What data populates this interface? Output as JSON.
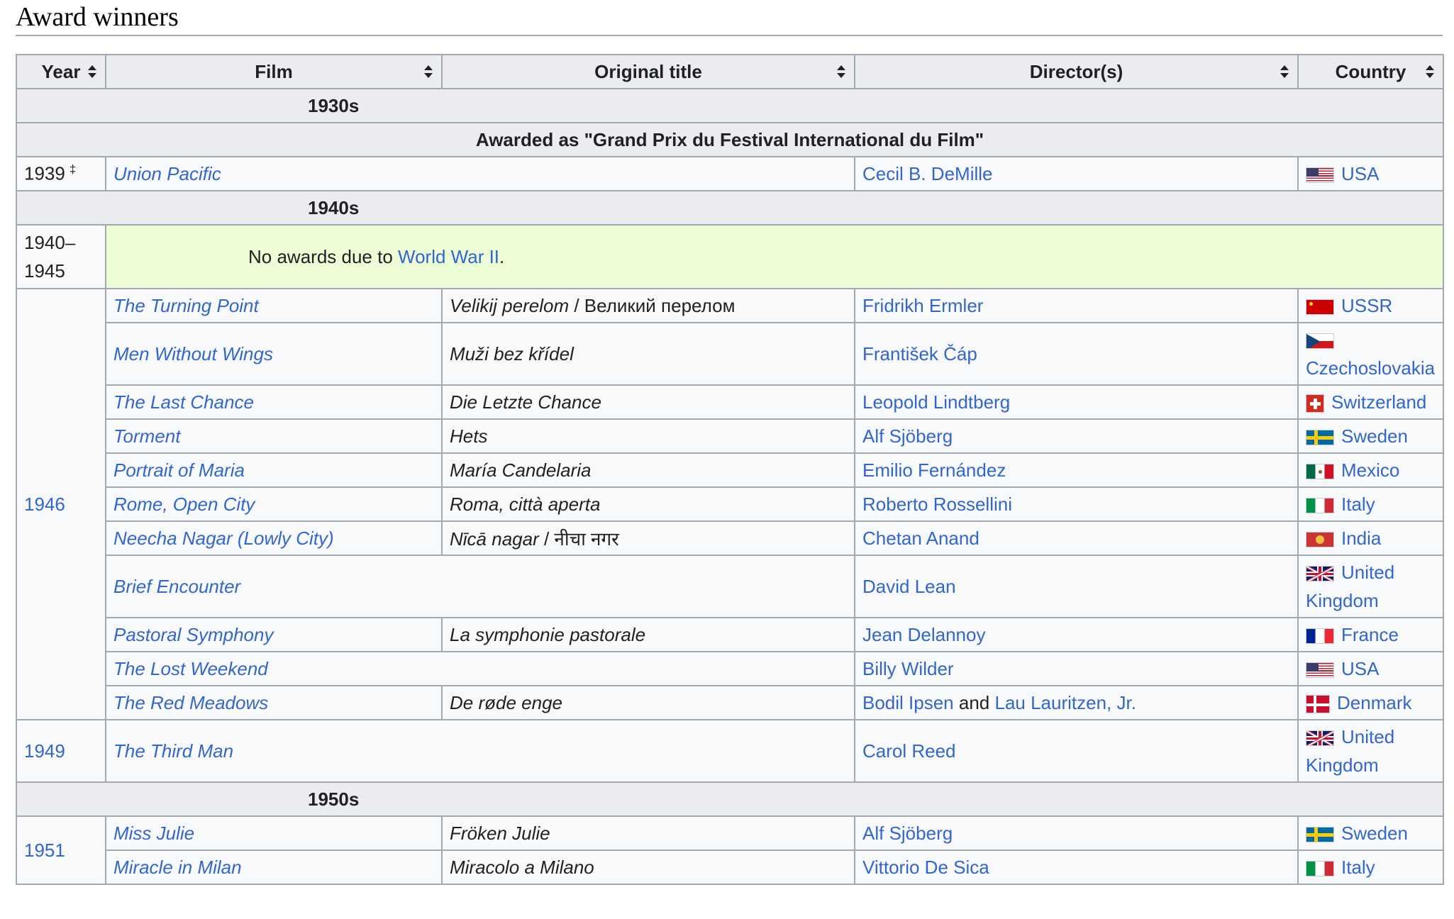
{
  "heading": "Award winners",
  "columns": [
    "Year",
    "Film",
    "Original title",
    "Director(s)",
    "Country"
  ],
  "decades": {
    "d1930": "1930s",
    "d1940": "1940s",
    "d1950": "1950s"
  },
  "subheading": "Awarded as \"Grand Prix du Festival International du Film\"",
  "note": {
    "prefix": "No awards due to ",
    "link": "World War II",
    "suffix": "."
  },
  "years": {
    "y1939": "1939",
    "y1939_mark": "‡",
    "y1940_45": "1940–\n1945",
    "y1946": "1946",
    "y1949": "1949",
    "y1951": "1951"
  },
  "rows": [
    {
      "film": "Union Pacific",
      "orig": "",
      "director": "Cecil B. DeMille",
      "country": "USA",
      "flag": "usa-flag-icon"
    },
    {
      "film": "The Turning Point",
      "orig": "Velikij perelom",
      "orig_extra": " / Великий перелом",
      "director": "Fridrikh Ermler",
      "country": "USSR",
      "flag": "ussr-flag-icon"
    },
    {
      "film": "Men Without Wings",
      "orig": "Muži bez křídel",
      "director": "František Čáp",
      "country": "Czechoslovakia",
      "flag": "czechoslovakia-flag-icon"
    },
    {
      "film": "The Last Chance",
      "orig": "Die Letzte Chance",
      "director": "Leopold Lindtberg",
      "country": "Switzerland",
      "flag": "switzerland-flag-icon"
    },
    {
      "film": "Torment",
      "orig": "Hets",
      "director": "Alf Sjöberg",
      "country": "Sweden",
      "flag": "sweden-flag-icon"
    },
    {
      "film": "Portrait of Maria",
      "orig": "María Candelaria",
      "director": "Emilio Fernández",
      "country": "Mexico",
      "flag": "mexico-flag-icon"
    },
    {
      "film": "Rome, Open City",
      "orig": "Roma, città aperta",
      "director": "Roberto Rossellini",
      "country": "Italy",
      "flag": "italy-flag-icon"
    },
    {
      "film": "Neecha Nagar (Lowly City)",
      "orig": "Nīcā nagar",
      "orig_extra": " / नीचा नगर",
      "director": "Chetan Anand",
      "country": "India",
      "flag": "india-flag-icon"
    },
    {
      "film": "Brief Encounter",
      "orig": "",
      "director": "David Lean",
      "country": "United Kingdom",
      "flag": "uk-flag-icon"
    },
    {
      "film": "Pastoral Symphony",
      "orig": "La symphonie pastorale",
      "director": "Jean Delannoy",
      "country": "France",
      "flag": "france-flag-icon"
    },
    {
      "film": "The Lost Weekend",
      "orig": "",
      "director": "Billy Wilder",
      "country": "USA",
      "flag": "usa-flag-icon"
    },
    {
      "film": "The Red Meadows",
      "orig": "De røde enge",
      "director": "Bodil Ipsen",
      "director_and": " and ",
      "director2": "Lau Lauritzen, Jr.",
      "country": "Denmark",
      "flag": "denmark-flag-icon"
    },
    {
      "film": "The Third Man",
      "orig": "",
      "director": "Carol Reed",
      "country": "United Kingdom",
      "flag": "uk-flag-icon"
    },
    {
      "film": "Miss Julie",
      "orig": "Fröken Julie",
      "director": "Alf Sjöberg",
      "country": "Sweden",
      "flag": "sweden-flag-icon"
    },
    {
      "film": "Miracle in Milan",
      "orig": "Miracolo a Milano",
      "director": "Vittorio De Sica",
      "country": "Italy",
      "flag": "italy-flag-icon"
    }
  ]
}
